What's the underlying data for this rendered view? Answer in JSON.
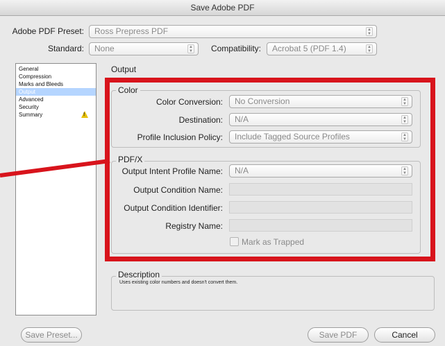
{
  "window": {
    "title": "Save Adobe PDF"
  },
  "header": {
    "preset_label": "Adobe PDF Preset:",
    "preset_value": "Ross Prepress PDF",
    "standard_label": "Standard:",
    "standard_value": "None",
    "compat_label": "Compatibility:",
    "compat_value": "Acrobat 5 (PDF 1.4)"
  },
  "sidebar": {
    "items": [
      {
        "label": "General",
        "selected": false
      },
      {
        "label": "Compression",
        "selected": false
      },
      {
        "label": "Marks and Bleeds",
        "selected": false
      },
      {
        "label": "Output",
        "selected": true
      },
      {
        "label": "Advanced",
        "selected": false
      },
      {
        "label": "Security",
        "selected": false
      },
      {
        "label": "Summary",
        "selected": false,
        "warning": true
      }
    ],
    "warning_icon": "warning-triangle-icon"
  },
  "main": {
    "section_title": "Output",
    "color_group": {
      "title": "Color",
      "color_conversion_label": "Color Conversion:",
      "color_conversion_value": "No Conversion",
      "destination_label": "Destination:",
      "destination_value": "N/A",
      "profile_policy_label": "Profile Inclusion Policy:",
      "profile_policy_value": "Include Tagged Source Profiles"
    },
    "pdfx_group": {
      "title": "PDF/X",
      "intent_profile_label": "Output Intent Profile Name:",
      "intent_profile_value": "N/A",
      "condition_name_label": "Output Condition Name:",
      "condition_name_value": "",
      "condition_id_label": "Output Condition Identifier:",
      "condition_id_value": "",
      "registry_label": "Registry Name:",
      "registry_value": "",
      "trapped_label": "Mark as Trapped",
      "trapped_checked": false
    },
    "description": {
      "title": "Description",
      "text": "Uses existing color numbers and doesn't convert them."
    }
  },
  "footer": {
    "save_preset_label": "Save Preset...",
    "save_pdf_label": "Save PDF",
    "cancel_label": "Cancel"
  },
  "colors": {
    "highlight_frame": "#d8141c",
    "selection": "#b5d5ff",
    "warning": "#e7c000"
  }
}
